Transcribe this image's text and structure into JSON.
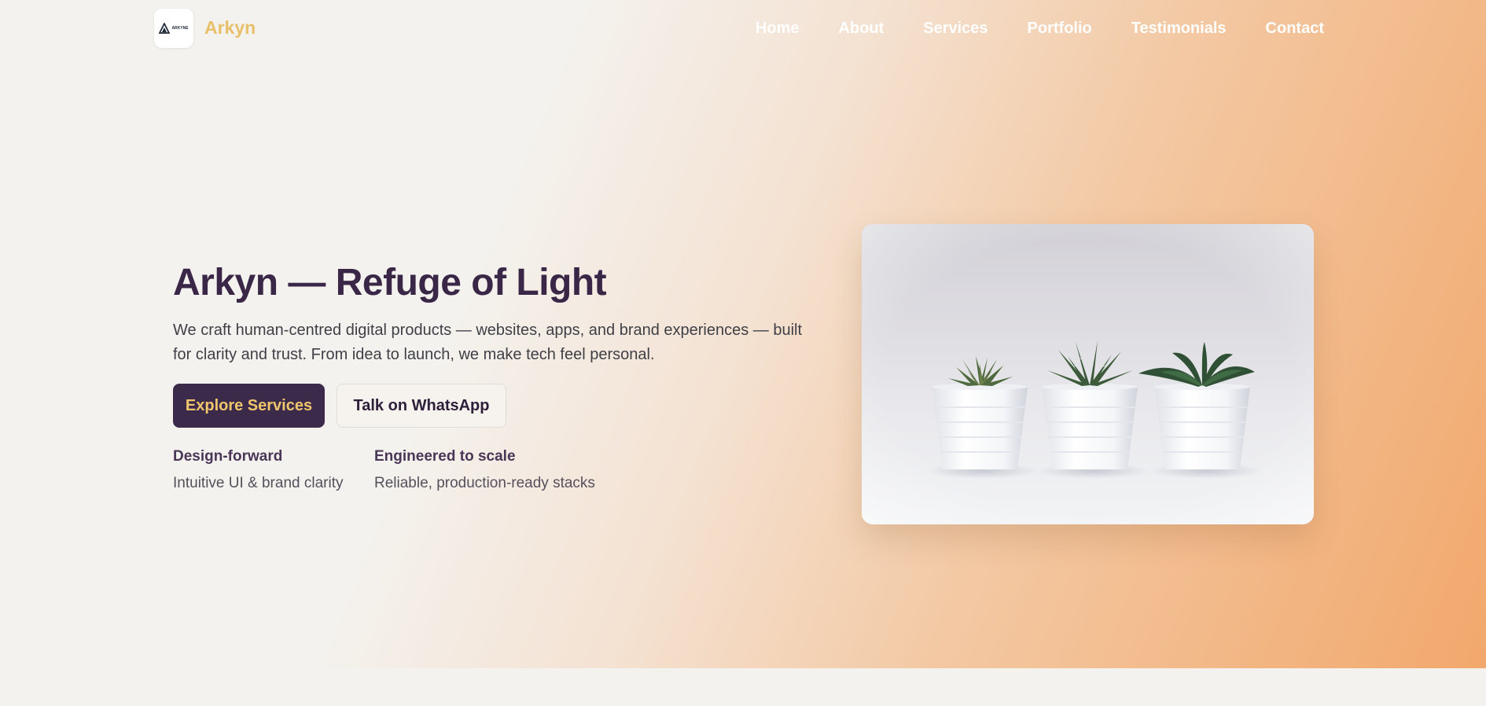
{
  "header": {
    "logo_alt": "Arkyn logo",
    "logo_text": "ARKYNE",
    "brand": "Arkyn",
    "nav": [
      {
        "label": "Home"
      },
      {
        "label": "About"
      },
      {
        "label": "Services"
      },
      {
        "label": "Portfolio"
      },
      {
        "label": "Testimonials"
      },
      {
        "label": "Contact"
      }
    ]
  },
  "hero": {
    "title": "Arkyn — Refuge of Light",
    "description": "We craft human-centred digital products — websites, apps, and brand experiences — built for clarity and trust. From idea to launch, we make tech feel personal.",
    "primary_button": "Explore Services",
    "secondary_button": "Talk on WhatsApp",
    "features": [
      {
        "title": "Design-forward",
        "description": "Intuitive UI & brand clarity"
      },
      {
        "title": "Engineered to scale",
        "description": "Reliable, production-ready stacks"
      }
    ],
    "image": {
      "subject": "three succulent plants in white pots"
    }
  },
  "colors": {
    "brand_gold": "#e8c06a",
    "primary_purple": "#3c2a4a",
    "gradient_orange": "#f2a86c",
    "page_background": "#f4f2ee"
  }
}
